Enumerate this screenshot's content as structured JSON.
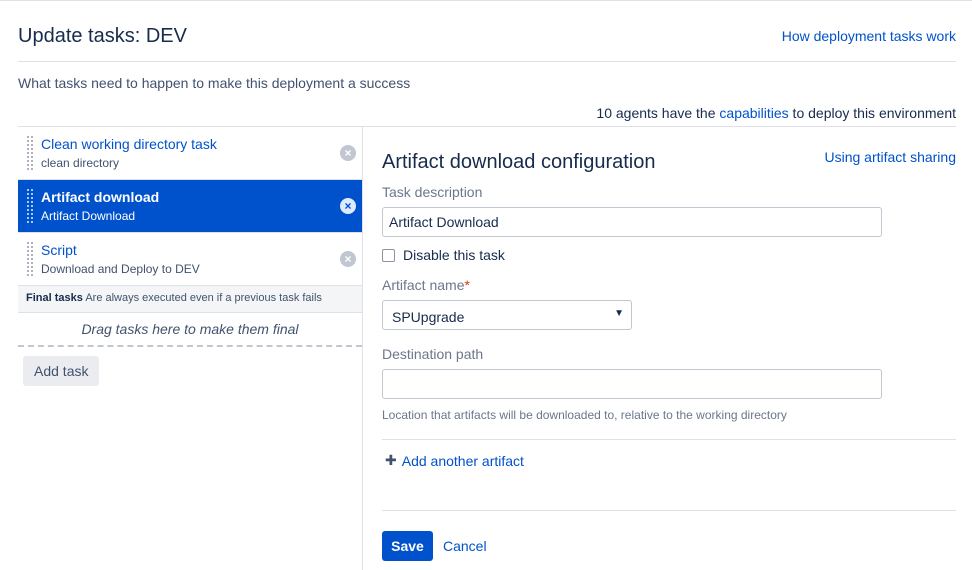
{
  "header": {
    "title": "Update tasks: DEV",
    "help_link": "How deployment tasks work",
    "description": "What tasks need to happen to make this deployment a success",
    "agents_prefix": "10 agents have the ",
    "agents_link": "capabilities",
    "agents_suffix": " to deploy this environment"
  },
  "tasks": [
    {
      "name": "Clean working directory task",
      "description": "clean directory",
      "active": false
    },
    {
      "name": "Artifact download",
      "description": "Artifact Download",
      "active": true
    },
    {
      "name": "Script",
      "description": "Download and Deploy to DEV",
      "active": false
    }
  ],
  "final_tasks": {
    "label": "Final tasks",
    "note": "Are always executed even if a previous task fails",
    "drop_hint": "Drag tasks here to make them final"
  },
  "add_task_label": "Add task",
  "remove_glyph": "×",
  "config": {
    "title": "Artifact download configuration",
    "sharing_link": "Using artifact sharing",
    "task_description_label": "Task description",
    "task_description_value": "Artifact Download",
    "disable_label": "Disable this task",
    "disable_checked": false,
    "artifact_name_label": "Artifact name",
    "required_mark": "*",
    "artifact_name_value": "SPUpgrade",
    "caret": "▼",
    "destination_label": "Destination path",
    "destination_value": "",
    "destination_help": "Location that artifacts will be downloaded to, relative to the working directory",
    "add_artifact_icon": "✚",
    "add_artifact_label": "Add another artifact",
    "save_label": "Save",
    "cancel_label": "Cancel"
  },
  "colors": {
    "accent": "#0052cc",
    "active_bg": "#0052cc",
    "required": "#de350b"
  }
}
